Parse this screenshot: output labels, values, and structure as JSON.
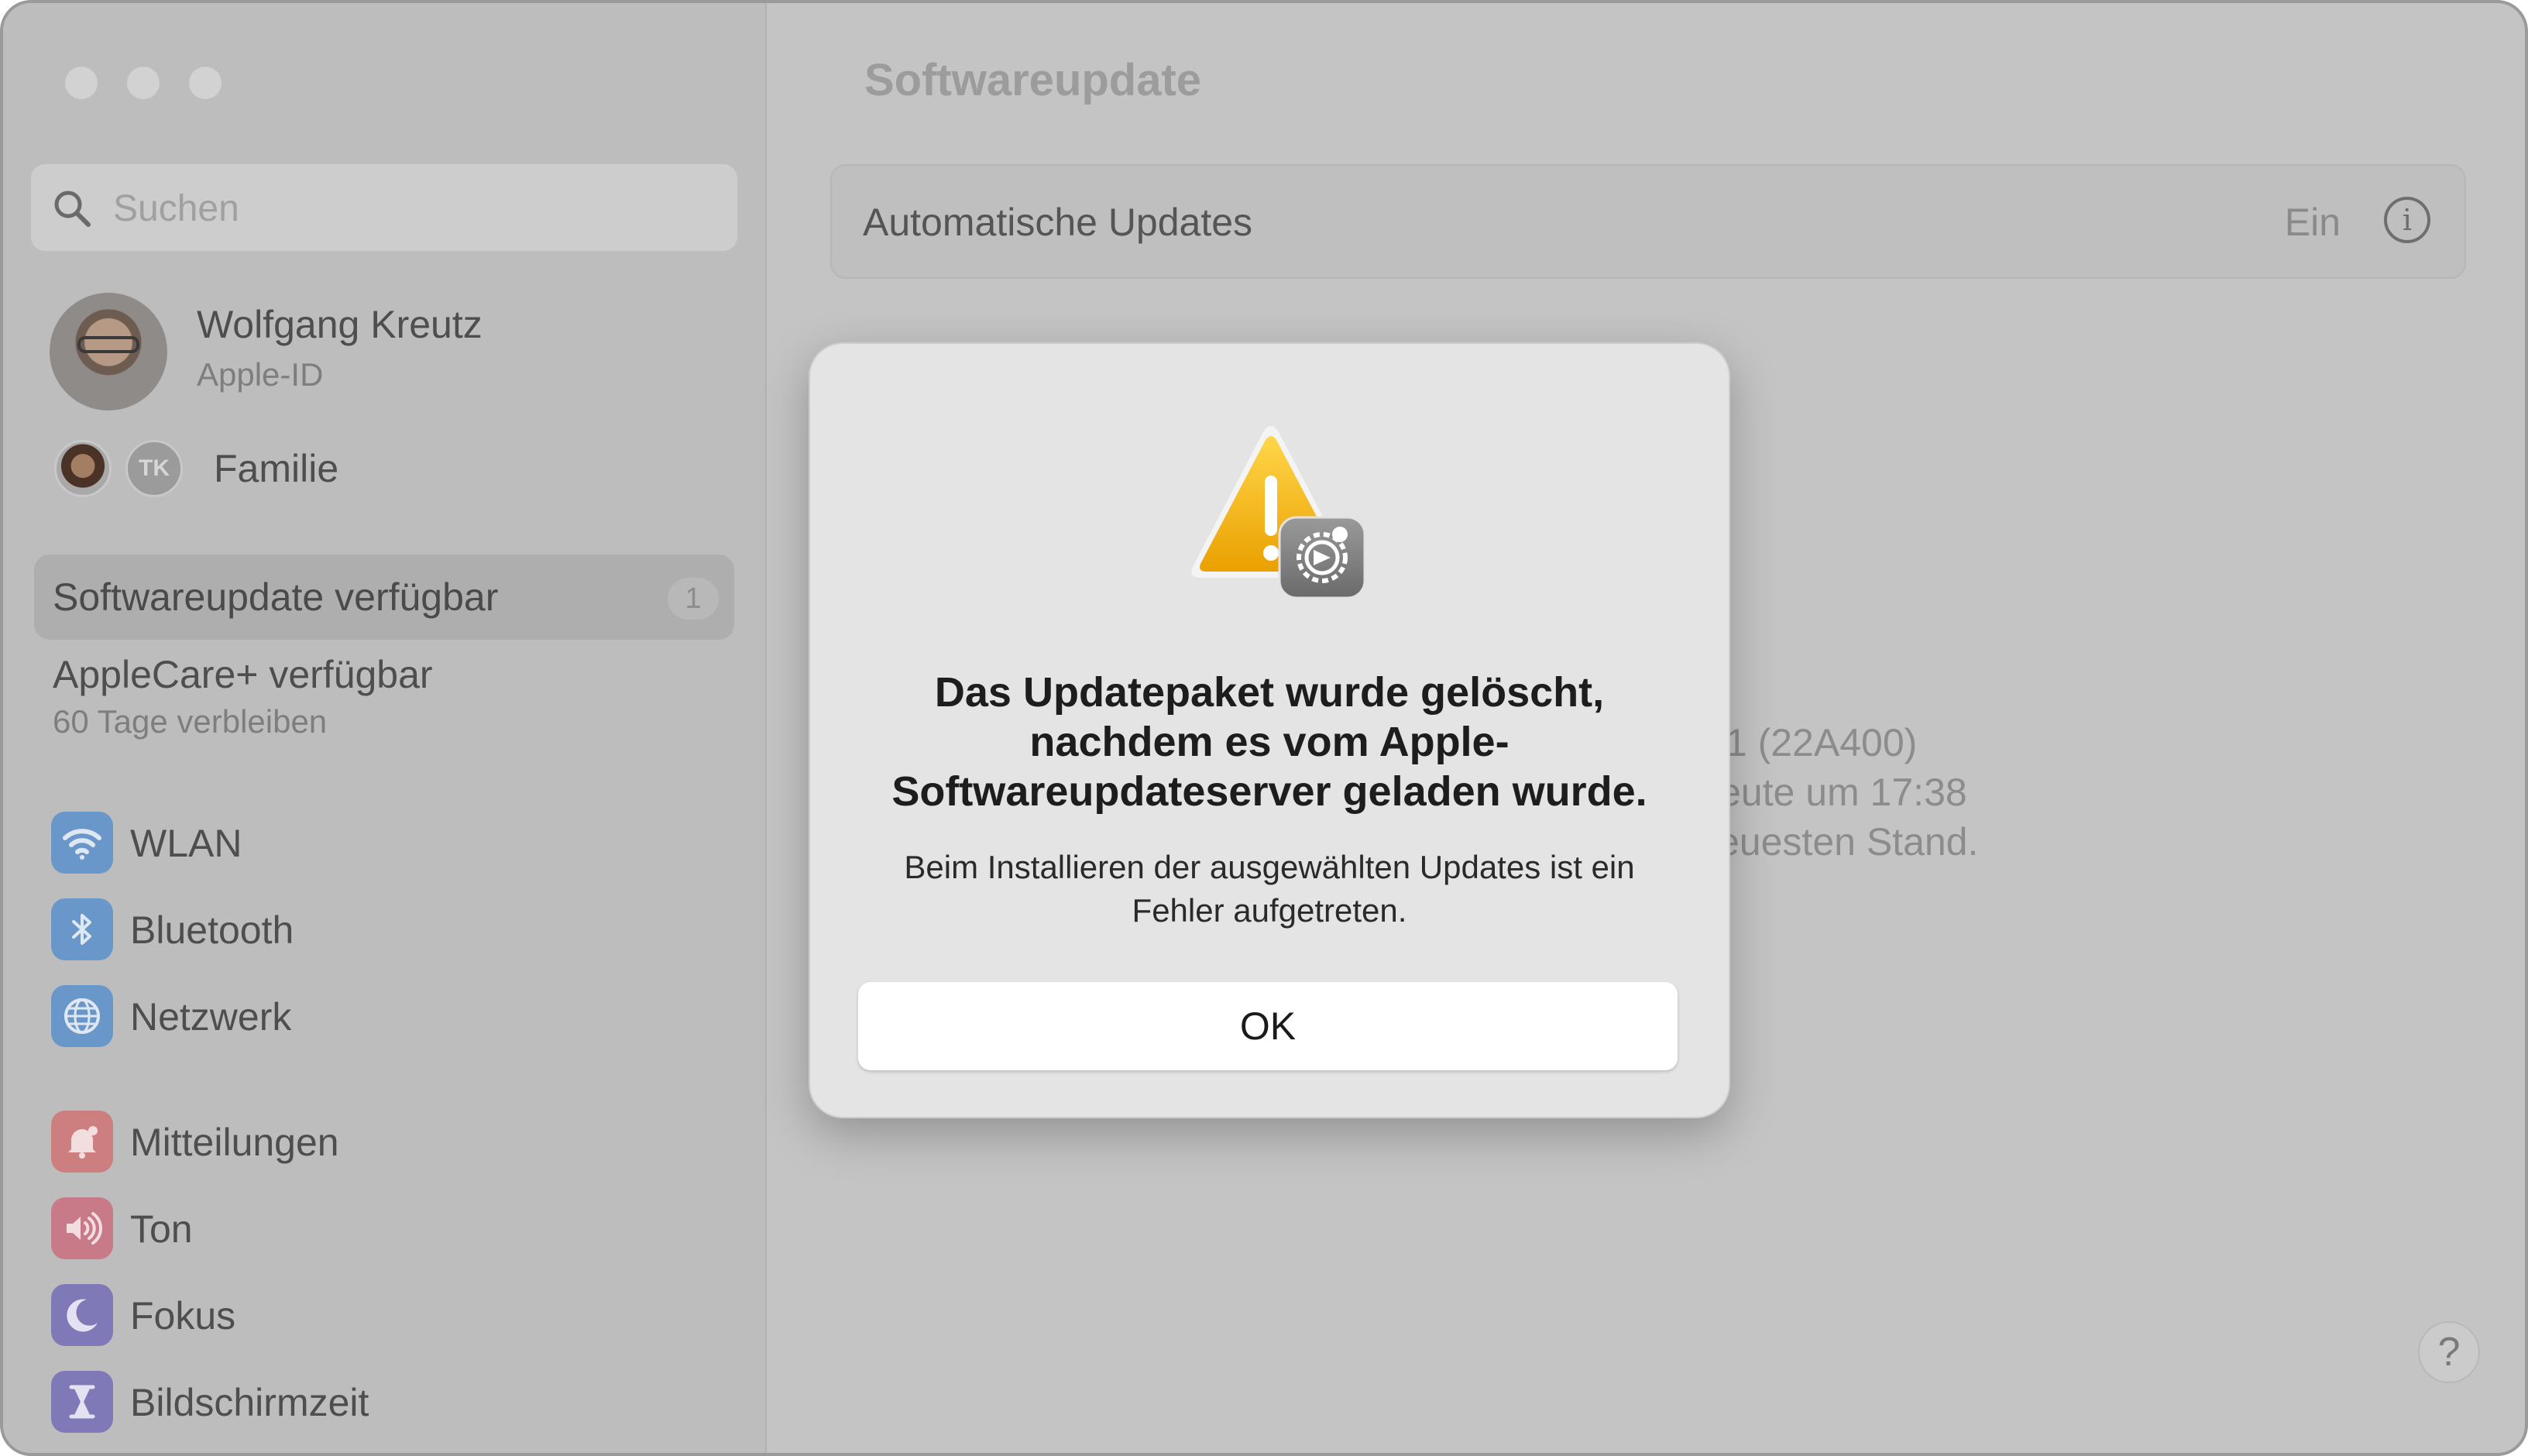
{
  "window": {
    "title": "Softwareupdate"
  },
  "sidebar": {
    "search_placeholder": "Suchen",
    "profile": {
      "name": "Wolfgang Kreutz",
      "subtitle": "Apple-ID"
    },
    "family": {
      "label": "Familie",
      "member_initials": "TK"
    },
    "selected_item": {
      "label": "Softwareupdate verfügbar",
      "badge": "1"
    },
    "applecare": {
      "title": "AppleCare+ verfügbar",
      "subtitle": "60 Tage verbleiben"
    },
    "items": [
      {
        "label": "WLAN",
        "icon": "wifi-icon"
      },
      {
        "label": "Bluetooth",
        "icon": "bluetooth-icon"
      },
      {
        "label": "Netzwerk",
        "icon": "globe-icon"
      },
      {
        "label": "Mitteilungen",
        "icon": "bell-icon"
      },
      {
        "label": "Ton",
        "icon": "speaker-icon"
      },
      {
        "label": "Fokus",
        "icon": "moon-icon"
      },
      {
        "label": "Bildschirmzeit",
        "icon": "hourglass-icon"
      }
    ]
  },
  "main": {
    "auto_updates": {
      "label": "Automatische Updates",
      "value": "Ein"
    },
    "status_lines": [
      ".1 (22A400)",
      "eute um 17:38",
      "euesten Stand."
    ]
  },
  "dialog": {
    "title": "Das Updatepaket wurde gelöscht, nachdem es vom Apple-Softwareupdateserver geladen wurde.",
    "message": "Beim Installieren der ausgewählten Updates ist ein Fehler aufgetreten.",
    "ok_label": "OK"
  },
  "help_label": "?",
  "colors": {
    "warning_yellow": "#f5b800",
    "icon_blue": "#6a97c9",
    "dialog_bg": "#e4e4e4"
  }
}
